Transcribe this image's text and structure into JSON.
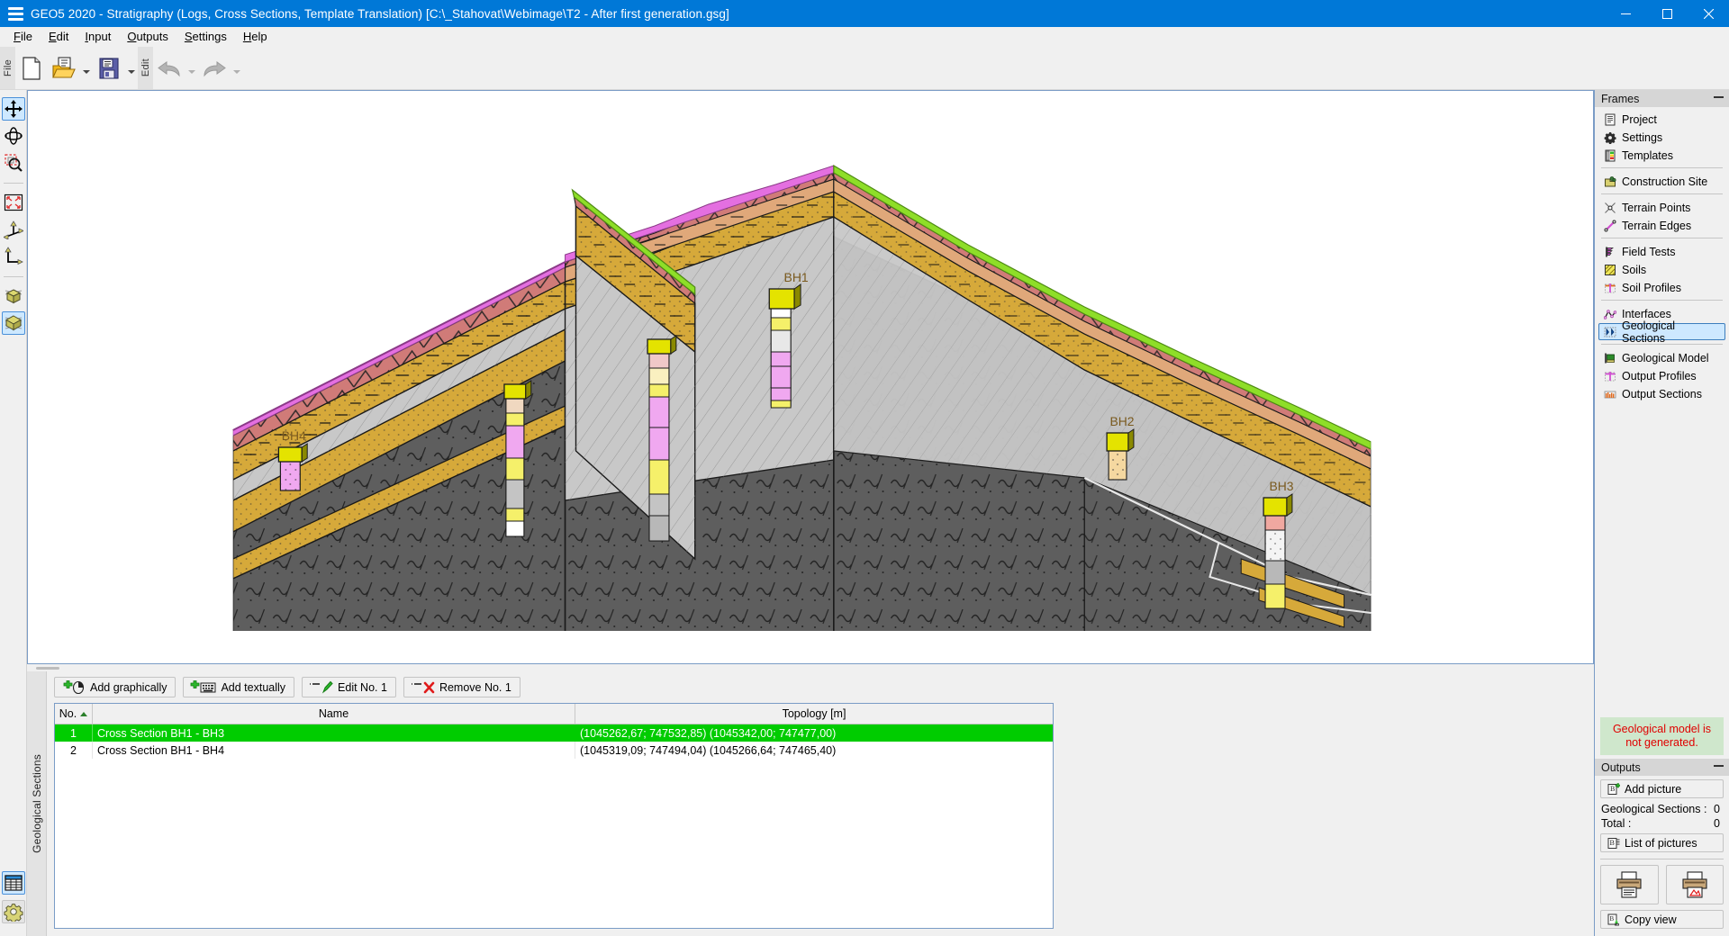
{
  "window": {
    "title": "GEO5 2020 - Stratigraphy (Logs, Cross Sections, Template Translation) [C:\\_Stahovat\\Webimage\\T2 -  After first generation.gsg]",
    "minimize_label": "Minimize",
    "maximize_label": "Maximize",
    "close_label": "Close"
  },
  "menu": {
    "items": [
      {
        "label": "File",
        "accel": "F"
      },
      {
        "label": "Edit",
        "accel": "E"
      },
      {
        "label": "Input",
        "accel": "I"
      },
      {
        "label": "Outputs",
        "accel": "O"
      },
      {
        "label": "Settings",
        "accel": "S"
      },
      {
        "label": "Help",
        "accel": "H"
      }
    ]
  },
  "toolbar": {
    "groups": [
      {
        "label": "File",
        "buttons": [
          {
            "name": "new-file-icon",
            "tip": "New"
          },
          {
            "name": "open-file-icon",
            "tip": "Open",
            "dropdown": true
          },
          {
            "name": "save-file-icon",
            "tip": "Save",
            "dropdown": true
          }
        ]
      },
      {
        "label": "Edit",
        "buttons": [
          {
            "name": "undo-icon",
            "tip": "Undo",
            "dropdown": true,
            "disabled": true
          },
          {
            "name": "redo-icon",
            "tip": "Redo",
            "dropdown": true,
            "disabled": true
          }
        ]
      }
    ]
  },
  "view_tools": [
    {
      "name": "pan-icon",
      "tip": "Move view",
      "selected": true
    },
    {
      "name": "rotate-icon",
      "tip": "Rotate view",
      "selected": false
    },
    {
      "name": "zoom-window-icon",
      "tip": "Zoom window",
      "selected": false
    },
    {
      "name": "fit-all-icon",
      "tip": "Fit all",
      "selected": false
    },
    {
      "name": "axes-3d-icon",
      "tip": "3D view",
      "selected": false
    },
    {
      "name": "axes-2d-icon",
      "tip": "2D view",
      "selected": false
    },
    {
      "name": "wireframe-cube-icon",
      "tip": "Wireframe",
      "selected": false
    },
    {
      "name": "solid-cube-icon",
      "tip": "Solid",
      "selected": true
    },
    {
      "name": "table-view-icon",
      "tip": "Table",
      "selected": true
    },
    {
      "name": "view-settings-icon",
      "tip": "View settings",
      "selected": false
    }
  ],
  "canvas": {
    "tab_label": "Geological Sections",
    "boreholes": [
      {
        "id": "BH1",
        "label": "BH1"
      },
      {
        "id": "BH2",
        "label": "BH2"
      },
      {
        "id": "BH3",
        "label": "BH3"
      },
      {
        "id": "BH4",
        "label": "BH4"
      }
    ],
    "layer_colors": {
      "topsoil_green": "#8ede28",
      "magenta": "#e46fe0",
      "salmon": "#d07b78",
      "tan": "#e0a87a",
      "gold": "#d6a93a",
      "light_gray": "#c8c8c8",
      "dark_gray": "#5e5e5e",
      "borehole_cap": "#e4e300",
      "pink": "#f0a8f0",
      "yellow": "#f5f06a"
    }
  },
  "table_actions": [
    {
      "name": "add-graphically-button",
      "label": "Add graphically",
      "icon": "plus-mouse-icon"
    },
    {
      "name": "add-textually-button",
      "label": "Add textually",
      "icon": "plus-keyboard-icon"
    },
    {
      "name": "edit-button",
      "label": "Edit No. 1",
      "icon": "pencil-icon"
    },
    {
      "name": "remove-button",
      "label": "Remove No. 1",
      "icon": "red-x-icon"
    }
  ],
  "table": {
    "columns": [
      "No.",
      "Name",
      "Topology [m]"
    ],
    "sort_column": "No.",
    "sort_direction": "asc",
    "rows": [
      {
        "no": "1",
        "name": "Cross Section BH1 - BH3",
        "topology": "(1045262,67; 747532,85) (1045342,00; 747477,00)",
        "selected": true
      },
      {
        "no": "2",
        "name": "Cross Section BH1 - BH4",
        "topology": "(1045319,09; 747494,04) (1045266,64; 747465,40)",
        "selected": false
      }
    ]
  },
  "frames": {
    "header": "Frames",
    "items": [
      {
        "label": "Project",
        "icon": "document-icon",
        "selected": false
      },
      {
        "label": "Settings",
        "icon": "gear-icon",
        "selected": false
      },
      {
        "label": "Templates",
        "icon": "templates-icon",
        "selected": false
      },
      {
        "label": "Construction Site",
        "icon": "site-icon",
        "selected": false
      },
      {
        "label": "Terrain Points",
        "icon": "terrain-point-icon",
        "selected": false
      },
      {
        "label": "Terrain Edges",
        "icon": "terrain-edge-icon",
        "selected": false
      },
      {
        "label": "Field Tests",
        "icon": "field-test-icon",
        "selected": false
      },
      {
        "label": "Soils",
        "icon": "soils-icon",
        "selected": false
      },
      {
        "label": "Soil Profiles",
        "icon": "soil-profile-icon",
        "selected": false
      },
      {
        "label": "Interfaces",
        "icon": "interfaces-icon",
        "selected": false
      },
      {
        "label": "Geological Sections",
        "icon": "geological-sections-icon",
        "selected": true
      },
      {
        "label": "Geological Model",
        "icon": "geological-model-icon",
        "selected": false
      },
      {
        "label": "Output Profiles",
        "icon": "output-profile-icon",
        "selected": false
      },
      {
        "label": "Output Sections",
        "icon": "output-section-icon",
        "selected": false
      }
    ],
    "separators_after": [
      2,
      3,
      5,
      8,
      9,
      10
    ]
  },
  "status": {
    "message_line1": "Geological model is",
    "message_line2": "not generated.",
    "bg_color": "#cfe7cc",
    "text_color": "#e00000"
  },
  "outputs": {
    "header": "Outputs",
    "add_picture_label": "Add picture",
    "counters": [
      {
        "label": "Geological Sections :",
        "value": "0"
      },
      {
        "label": "Total :",
        "value": "0"
      }
    ],
    "list_of_pictures_label": "List of pictures",
    "print_buttons": [
      {
        "name": "print-document-button",
        "tip": "Print document"
      },
      {
        "name": "print-picture-button",
        "tip": "Print picture"
      }
    ],
    "copy_view_label": "Copy view"
  }
}
